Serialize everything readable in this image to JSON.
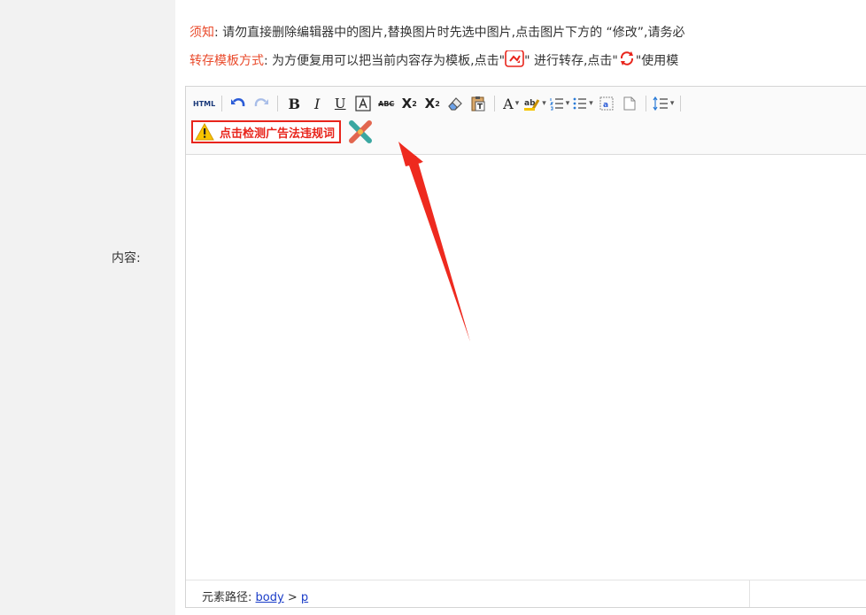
{
  "form": {
    "content_label": "内容:"
  },
  "notes": {
    "line1_label": "须知",
    "line1_text": ": 请勿直接删除编辑器中的图片,替换图片时先选中图片,点击图片下方的 “修改”,请务必",
    "line2_label": "转存模板方式",
    "line2_text_a": ": 为方便复用可以把当前内容存为模板,点击\"",
    "line2_text_b": "\" 进行转存,点击\"",
    "line2_text_c": "\"使用模"
  },
  "toolbar": {
    "html_label": "HTML",
    "bold_label": "B",
    "italic_label": "I",
    "underline_label": "U",
    "strike_label": "ABC",
    "superscript_label": "X",
    "subscript_label": "X",
    "fontcolor_label": "A",
    "caret": "▾",
    "ad_check_label": "点击检测广告法违规词"
  },
  "statusbar": {
    "path_label": "元素路径:",
    "path_body": "body",
    "path_sep": ">",
    "path_p": "p"
  },
  "colors": {
    "accent_red": "#e8241b",
    "label_red": "#e94a2b",
    "link_blue": "#1a3cc8",
    "sidebar_bg": "#f2f2f2"
  }
}
